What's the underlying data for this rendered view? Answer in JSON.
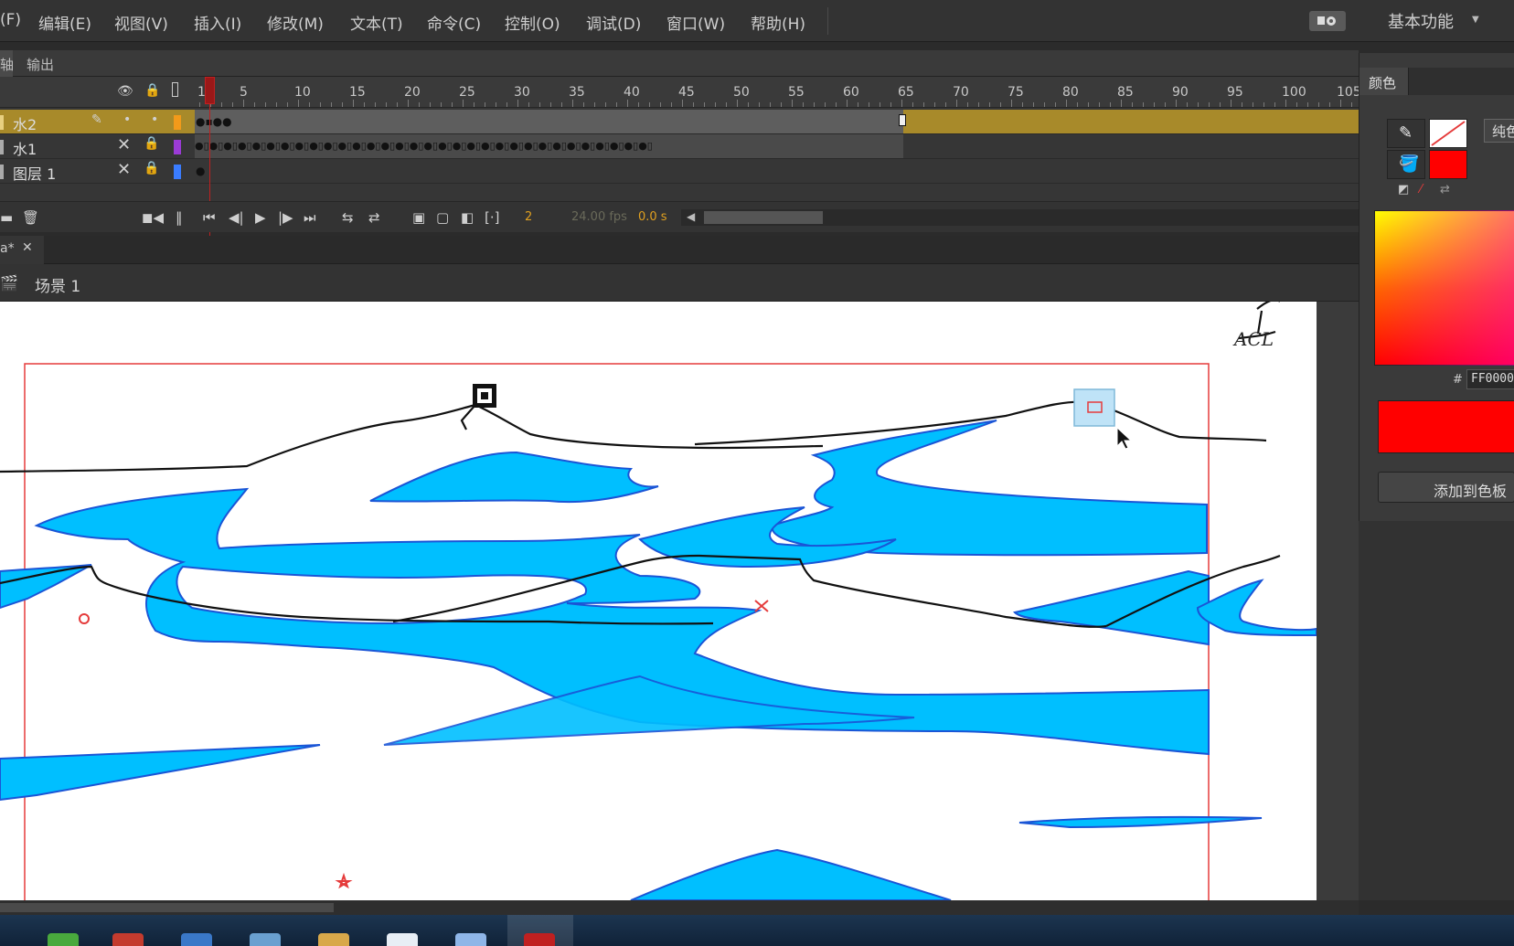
{
  "menu": {
    "items": [
      "(F)",
      "编辑(E)",
      "视图(V)",
      "插入(I)",
      "修改(M)",
      "文本(T)",
      "命令(C)",
      "控制(O)",
      "调试(D)",
      "窗口(W)",
      "帮助(H)"
    ],
    "workspace_label": "基本功能"
  },
  "panel_tabs": {
    "timeline": "轴",
    "output": "输出"
  },
  "timeline": {
    "ruler": [
      "1",
      "5",
      "10",
      "15",
      "20",
      "25",
      "30",
      "35",
      "40",
      "45",
      "50",
      "55",
      "60",
      "65",
      "70",
      "75",
      "80",
      "85",
      "90",
      "95",
      "100",
      "105"
    ],
    "layers": [
      {
        "name": "水2",
        "color": "#f29a1a",
        "selected": true
      },
      {
        "name": "水1",
        "color": "#9b3bd6",
        "selected": false
      },
      {
        "name": "图层 1",
        "color": "#3a7cff",
        "selected": false
      }
    ],
    "current_frame": "2",
    "fps": "24.00 fps",
    "elapsed": "0.0 s"
  },
  "document": {
    "tab_label": "a*",
    "scene_label": "场景 1"
  },
  "stage": {
    "annotation": "ACL"
  },
  "color_panel": {
    "title": "颜色",
    "fill_type_label": "纯色",
    "stroke_color": "none",
    "fill_color": "#ff0000",
    "hex_label": "#",
    "hex_value": "FF0000",
    "add_button": "添加到色板"
  },
  "colors": {
    "accent_selected_layer": "#a88a2a",
    "stage_fill_blue": "#00bfff",
    "stage_line_blue": "#1a55d6"
  }
}
